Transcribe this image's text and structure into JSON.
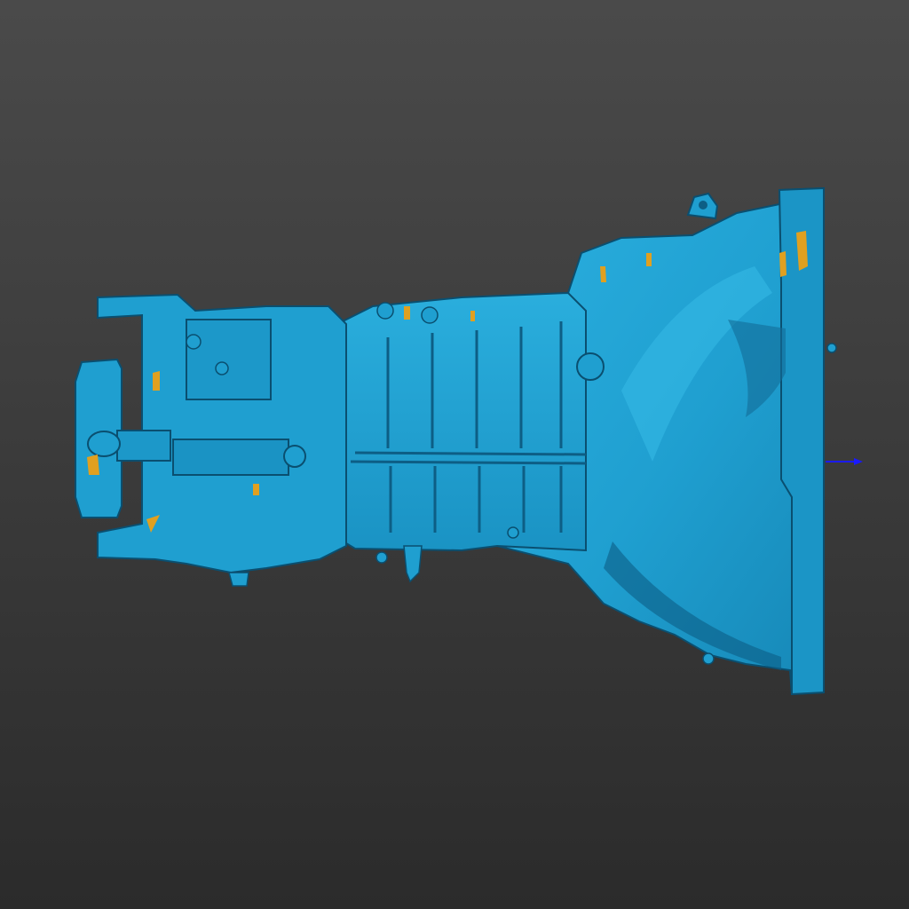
{
  "viewport": {
    "background_top": "#4a4a4a",
    "background_bottom": "#2b2b2b"
  },
  "model": {
    "icon": "gearbox-mesh-icon",
    "body_color": "#1f9fd0",
    "highlight_color": "#35b8e6",
    "shadow_color": "#106d96",
    "edge_color": "#0a4f70",
    "backface_color": "#e0a020"
  },
  "axis_gizmo": {
    "icon": "axis-arrow-icon",
    "color": "#1a1aff"
  }
}
